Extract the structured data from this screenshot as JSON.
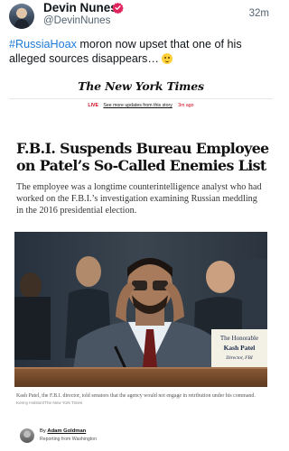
{
  "tweet": {
    "display_name": "Devin Nunes",
    "handle": "@DevinNunes",
    "timestamp": "32m",
    "hashtag": "#RussiaHoax",
    "text": " moron now upset that one of his alleged sources disappears…",
    "emoji": "slightly-smiling-face",
    "verified_color": "#e0245e"
  },
  "article": {
    "masthead": "The New York Times",
    "live": {
      "tag": "LIVE",
      "link": "See more updates from this story",
      "time": "3m ago"
    },
    "headline": "F.B.I. Suspends Bureau Employee on Patel’s So-Called Enemies List",
    "summary": "The employee was a longtime counterintelligence analyst who had worked on the F.B.I.’s investigation examining Russian meddling in the 2016 presidential election.",
    "photo": {
      "placard_line1": "The Honorable",
      "placard_line2": "Kash Patel",
      "placard_line3": "Director, FBI"
    },
    "caption": "Kash Patel, the F.B.I. director, told senators that the agency would not engage in retribution under his command.",
    "credit": "Kenny Holston/The New York Times",
    "byline_prefix": "By ",
    "author": "Adam Goldman",
    "location": "Reporting from Washington"
  },
  "colors": {
    "hashtag": "#1d7bd7",
    "live_red": "#d0021b"
  }
}
